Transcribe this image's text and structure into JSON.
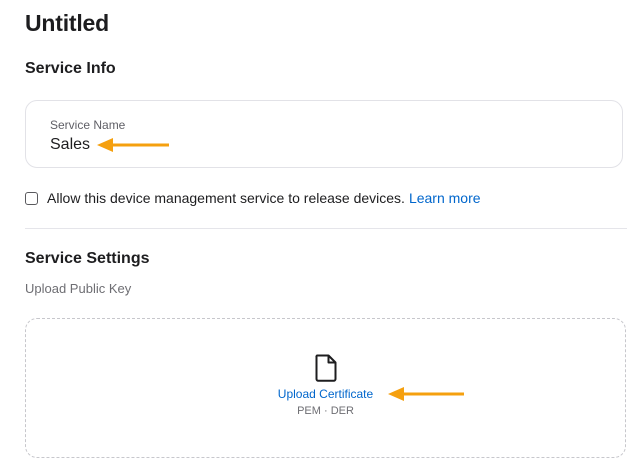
{
  "page": {
    "title": "Untitled"
  },
  "service_info": {
    "heading": "Service Info",
    "name_label": "Service Name",
    "name_value": "Sales"
  },
  "release": {
    "checkbox_label": "Allow this device management service to release devices.",
    "learn_more": "Learn more",
    "checked": false
  },
  "service_settings": {
    "heading": "Service Settings",
    "upload_label": "Upload Public Key",
    "upload_link": "Upload Certificate",
    "formats": "PEM · DER"
  },
  "icons": {
    "document": "document-icon",
    "annotation_arrow": "arrow-left-icon"
  },
  "colors": {
    "link": "#0066cc",
    "annotation": "#f5a00f",
    "border": "#e2e2e7"
  }
}
